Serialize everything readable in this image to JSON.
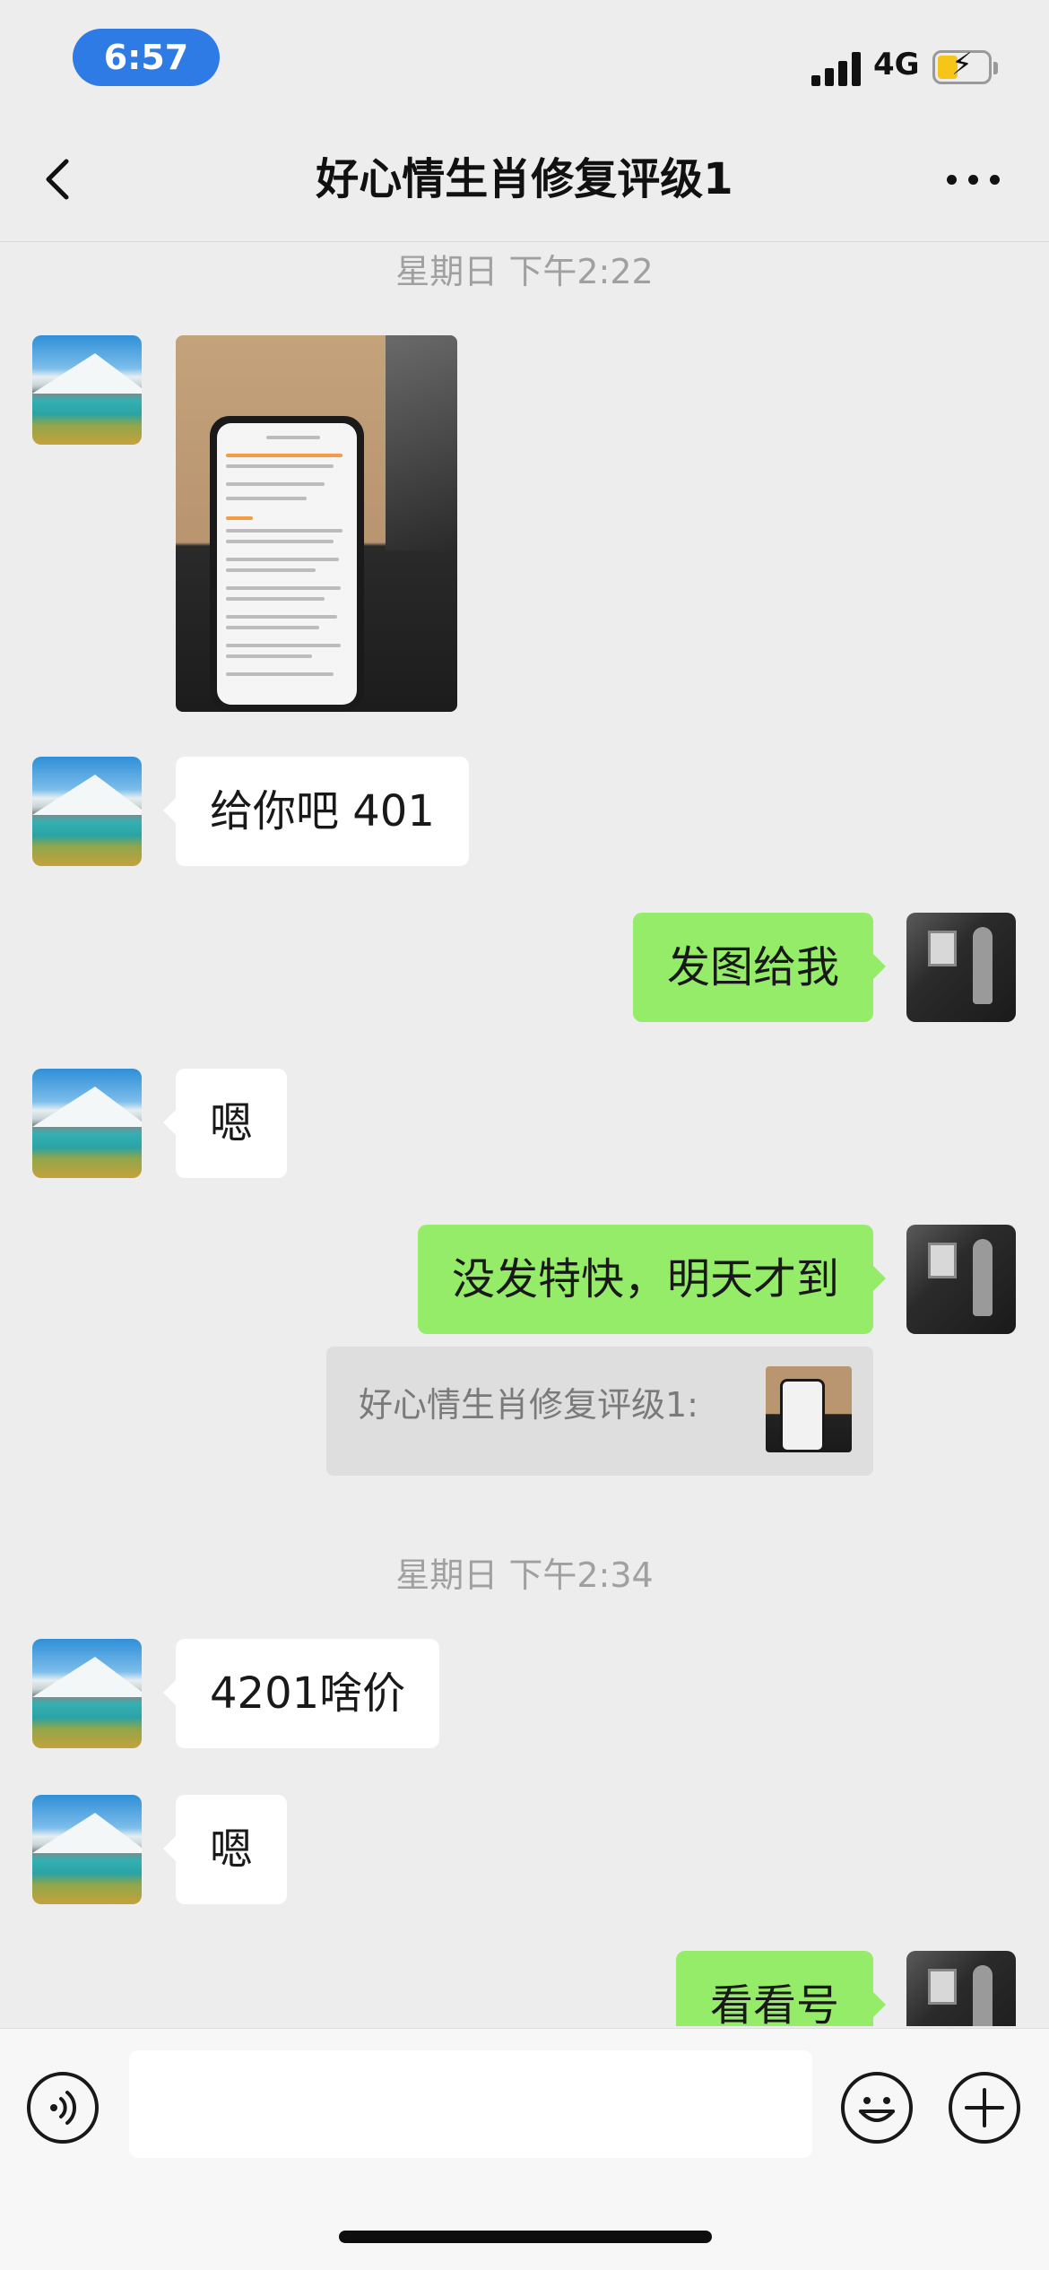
{
  "status_bar": {
    "time": "6:57",
    "network": "4G",
    "battery_icon": "battery-charging-icon",
    "signal_icon": "cellular-signal-icon"
  },
  "header": {
    "title": "好心情生肖修复评级1",
    "back_icon": "chevron-left-icon",
    "more_icon": "more-dots-icon"
  },
  "messages": [
    {
      "type": "timestamp",
      "text": "星期日 下午2:22"
    },
    {
      "type": "image",
      "sender": "them"
    },
    {
      "type": "text",
      "sender": "them",
      "text": "给你吧 401"
    },
    {
      "type": "text",
      "sender": "me",
      "text": "发图给我"
    },
    {
      "type": "text",
      "sender": "them",
      "text": "嗯"
    },
    {
      "type": "text",
      "sender": "me",
      "text": "没发特快，明天才到"
    },
    {
      "type": "quote",
      "sender": "me",
      "text": "好心情生肖修复评级1:"
    },
    {
      "type": "timestamp",
      "text": "星期日 下午2:34"
    },
    {
      "type": "text",
      "sender": "them",
      "text": "4201啥价"
    },
    {
      "type": "text",
      "sender": "them",
      "text": "嗯"
    },
    {
      "type": "text",
      "sender": "me",
      "text": "看看号"
    }
  ],
  "input_bar": {
    "voice_icon": "voice-icon",
    "emoji_icon": "emoji-icon",
    "plus_icon": "plus-icon",
    "text_value": ""
  },
  "colors": {
    "background": "#ededed",
    "my_bubble": "#95ec69",
    "their_bubble": "#ffffff",
    "time_pill": "#2f7be5"
  }
}
